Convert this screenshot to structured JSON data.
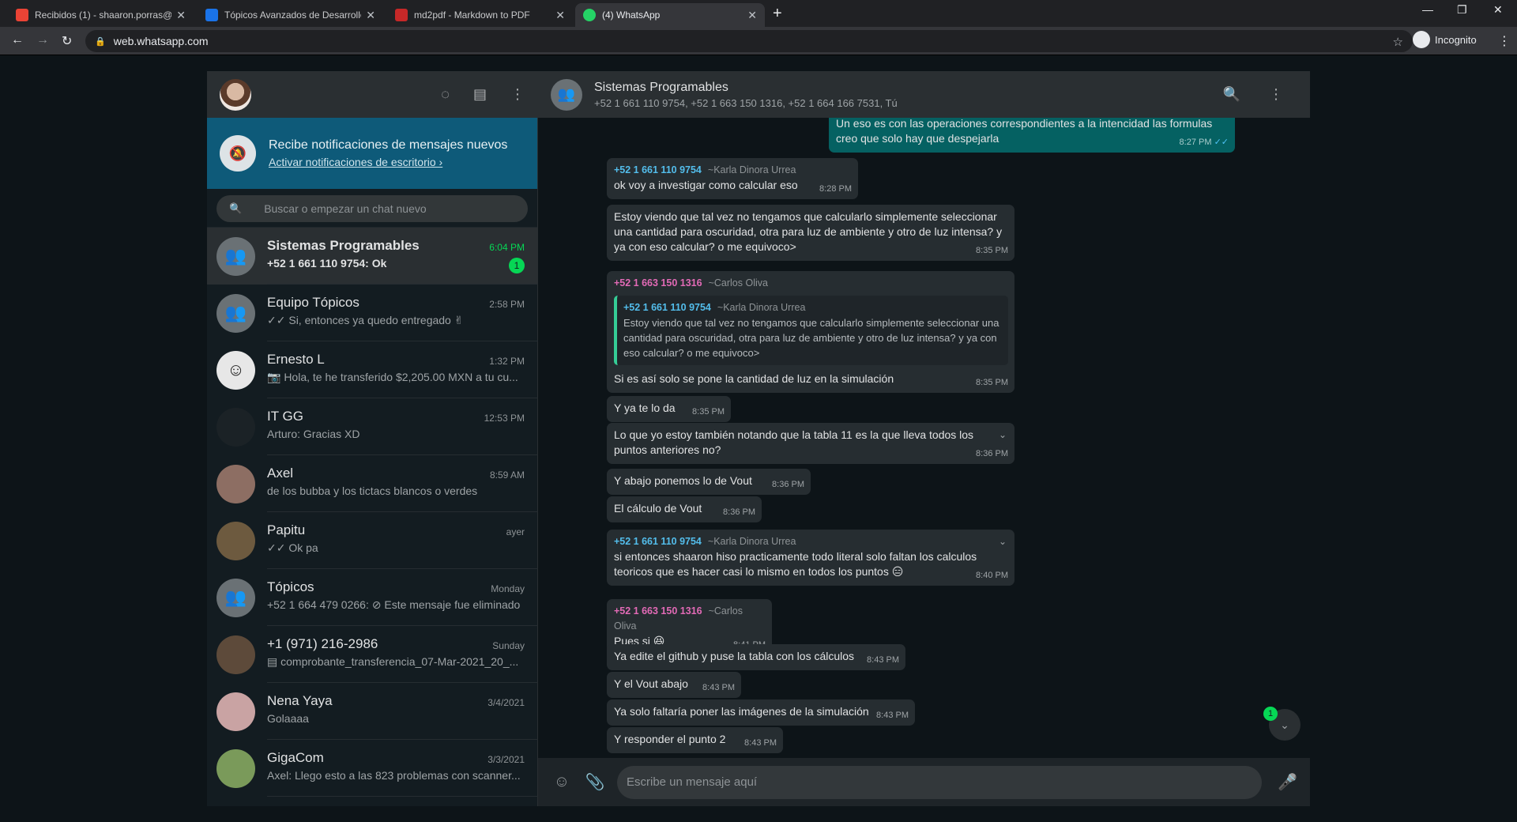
{
  "browser": {
    "tabs": [
      {
        "title": "Recibidos (1) - shaaron.porras@",
        "color": "#ea4335"
      },
      {
        "title": "Tópicos Avanzados de Desarrollo",
        "color": "#1a73e8"
      },
      {
        "title": "md2pdf - Markdown to PDF",
        "color": "#c62828"
      },
      {
        "title": "(4) WhatsApp",
        "color": "#25d366"
      }
    ],
    "new_tab": "+",
    "url": "web.whatsapp.com",
    "profile": "Incognito"
  },
  "sidebar": {
    "notification": {
      "title": "Recibe notificaciones de mensajes nuevos",
      "link": "Activar notificaciones de escritorio ›"
    },
    "search_placeholder": "Buscar o empezar un chat nuevo",
    "chats": [
      {
        "name": "Sistemas Programables",
        "time": "6:04 PM",
        "last": "+52 1 661 110 9754: Ok",
        "badge": "1"
      },
      {
        "name": "Equipo Tópicos",
        "time": "2:58 PM",
        "last": "✓✓ Si, entonces ya quedo entregado ✌"
      },
      {
        "name": "Ernesto L",
        "time": "1:32 PM",
        "last": "📷 Hola, te he transferido $2,205.00 MXN a tu cu..."
      },
      {
        "name": "IT GG",
        "time": "12:53 PM",
        "last": "Arturo: Gracias XD"
      },
      {
        "name": "Axel",
        "time": "8:59 AM",
        "last": "de los bubba y los tictacs blancos o verdes"
      },
      {
        "name": "Papitu",
        "time": "ayer",
        "last": "✓✓ Ok pa"
      },
      {
        "name": "Tópicos",
        "time": "Monday",
        "last": "+52 1 664 479 0266: ⊘ Este mensaje fue eliminado"
      },
      {
        "name": "+1 (971) 216-2986",
        "time": "Sunday",
        "last": "▤ comprobante_transferencia_07-Mar-2021_20_..."
      },
      {
        "name": "Nena Yaya",
        "time": "3/4/2021",
        "last": "Golaaaa"
      },
      {
        "name": "GigaCom",
        "time": "3/3/2021",
        "last": "Axel: Llego esto a las 823 problemas con scanner..."
      }
    ]
  },
  "conversation": {
    "title": "Sistemas Programables",
    "members": "+52 1 661 110 9754, +52 1 663 150 1316, +52 1 664 166 7531, Tú",
    "messages": {
      "m0": {
        "text1": "Un eso es con las operaciones correspondientes a la intencidad las formulas",
        "text2": "creo que solo hay que despejarla",
        "time": "8:27 PM"
      },
      "m1": {
        "sender": "+52 1 661 110 9754",
        "alias": "~Karla Dinora Urrea",
        "text": "ok voy a investigar como calcular eso",
        "time": "8:28 PM"
      },
      "m2": {
        "text1": "Estoy viendo que tal vez no tengamos que calcularlo simplemente seleccionar",
        "text2": "una cantidad para oscuridad, otra para luz de ambiente y otro de luz intensa? y",
        "text3": "ya con eso calcular? o me equivoco>",
        "time": "8:35 PM"
      },
      "m3": {
        "sender": "+52 1 663 150 1316",
        "alias": "~Carlos Oliva",
        "quote_sender": "+52 1 661 110 9754",
        "quote_alias": "~Karla Dinora Urrea",
        "quote1": "Estoy viendo que tal vez no tengamos que calcularlo simplemente seleccionar una",
        "quote2": "cantidad para oscuridad, otra para luz de ambiente y otro de luz intensa? y ya con",
        "quote3": "eso calcular? o me equivoco>",
        "text": "Si es así solo se pone la cantidad de luz en la simulación",
        "time": "8:35 PM"
      },
      "m4": {
        "text": "Y ya te lo da",
        "time": "8:35 PM"
      },
      "m5": {
        "text1": "Lo que yo estoy también notando que la tabla 11 es la que lleva todos los",
        "text2": "puntos anteriores no?",
        "time": "8:36 PM"
      },
      "m6": {
        "text": "Y abajo ponemos lo de Vout",
        "time": "8:36 PM"
      },
      "m7": {
        "text": "El cálculo de Vout",
        "time": "8:36 PM"
      },
      "m8": {
        "sender": "+52 1 661 110 9754",
        "alias": "~Karla Dinora Urrea",
        "text1": "si entonces shaaron hiso practicamente todo literal solo faltan los calculos",
        "text2": "teoricos que es hacer casi lo mismo  en todos los puntos 😑",
        "time": "8:40 PM"
      },
      "m9": {
        "sender": "+52 1 663 150 1316",
        "alias": "~Carlos Oliva",
        "text": "Pues si 😆",
        "time": "8:41 PM"
      },
      "m10": {
        "text": "Ya edite el github y puse la tabla con los cálculos",
        "time": "8:43 PM"
      },
      "m11": {
        "text": "Y el Vout abajo",
        "time": "8:43 PM"
      },
      "m12": {
        "text": "Ya solo faltaría poner las imágenes de la simulación",
        "time": "8:43 PM"
      },
      "m13": {
        "text": "Y responder el punto 2",
        "time": "8:43 PM"
      }
    },
    "unread_count": "1",
    "compose_placeholder": "Escribe un mensaje aquí"
  },
  "colors": {
    "accent_green": "#06d755",
    "sender_blue": "#53bdeb",
    "sender_pink": "#e26ab6",
    "outgoing_bubble": "#056162",
    "incoming_bubble": "#262d31"
  }
}
